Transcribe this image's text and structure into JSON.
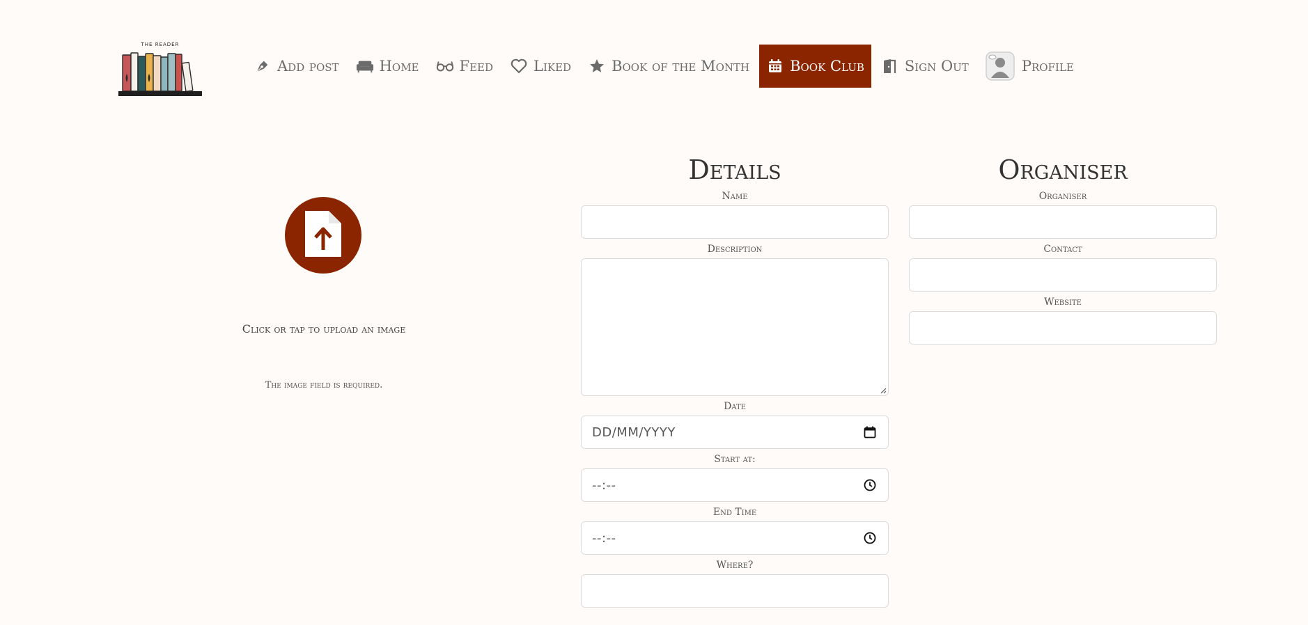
{
  "brand": {
    "logo_text": "THE READER"
  },
  "nav": {
    "items": [
      {
        "label": "Add post",
        "icon": "pen-nib-icon"
      },
      {
        "label": "Home",
        "icon": "couch-icon"
      },
      {
        "label": "Feed",
        "icon": "glasses-icon"
      },
      {
        "label": "Liked",
        "icon": "heart-icon"
      },
      {
        "label": "Book of the Month",
        "icon": "star-icon"
      },
      {
        "label": "Book Club",
        "icon": "calendar-icon",
        "active": true
      },
      {
        "label": "Sign Out",
        "icon": "door-icon"
      },
      {
        "label": "Profile",
        "icon": "avatar-icon"
      }
    ]
  },
  "upload": {
    "icon": "file-upload-icon",
    "label": "Click or tap to upload an image",
    "error": "The image field is required."
  },
  "details": {
    "title": "Details",
    "name_label": "Name",
    "name_value": "",
    "description_label": "Description",
    "description_value": "",
    "date_label": "Date",
    "date_value": "DD/MM/YYYY",
    "start_label": "Start at:",
    "start_value": "--:--",
    "end_label": "End Time",
    "end_value": "--:--",
    "where_label": "Where?",
    "where_value": ""
  },
  "organiser": {
    "title": "Organiser",
    "organiser_label": "Organiser",
    "organiser_value": "",
    "contact_label": "Contact",
    "contact_value": "",
    "website_label": "Website",
    "website_value": ""
  },
  "colors": {
    "accent": "#8b2500",
    "background": "#fefbf8",
    "nav_text": "#6b6b6b"
  }
}
